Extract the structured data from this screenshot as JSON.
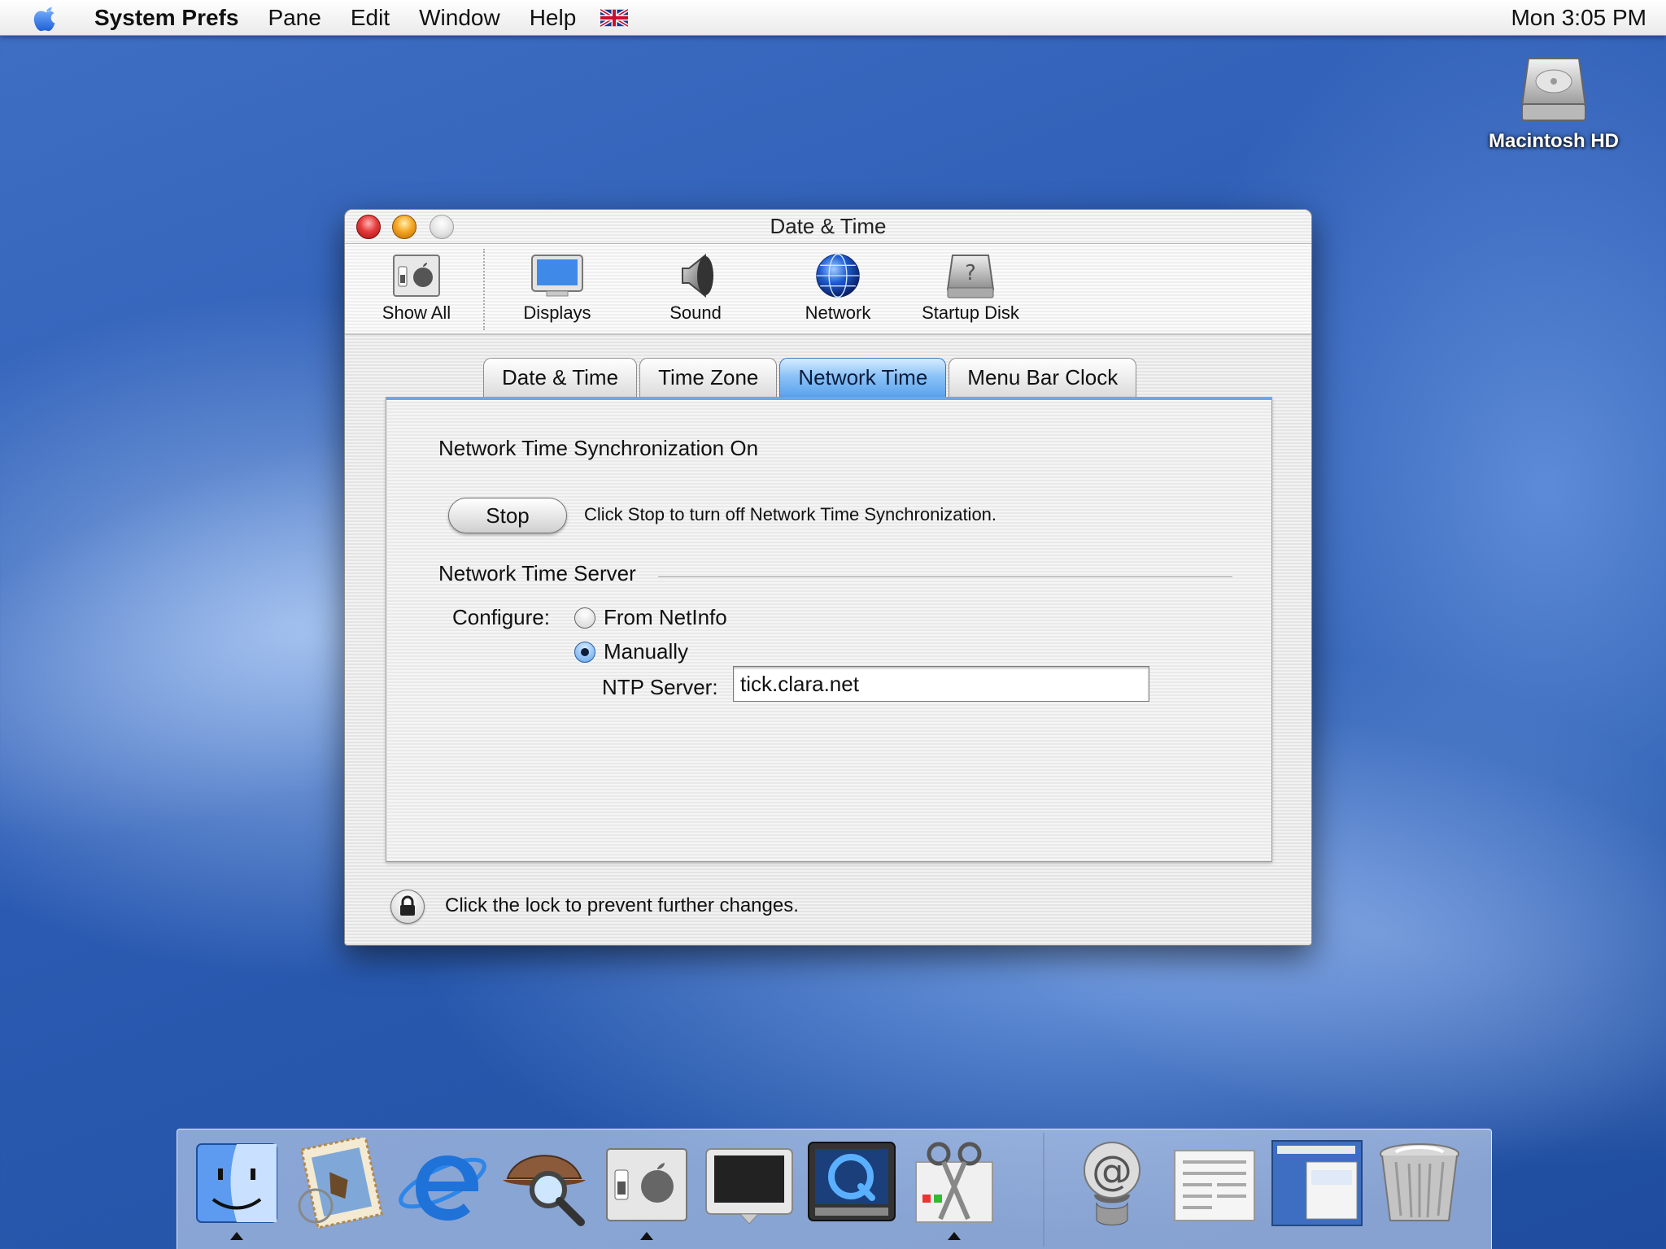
{
  "menubar": {
    "app_name": "System Prefs",
    "items": [
      "Pane",
      "Edit",
      "Window",
      "Help"
    ],
    "clock": "Mon 3:05 PM"
  },
  "desktop": {
    "drive_label": "Macintosh HD"
  },
  "window": {
    "title": "Date & Time",
    "toolbar": [
      {
        "label": "Show All",
        "icon": "switch-apple-icon"
      },
      {
        "label": "Displays",
        "icon": "monitor-icon"
      },
      {
        "label": "Sound",
        "icon": "speaker-icon"
      },
      {
        "label": "Network",
        "icon": "globe-icon"
      },
      {
        "label": "Startup Disk",
        "icon": "hard-disk-question-icon"
      }
    ],
    "tabs": [
      {
        "label": "Date & Time",
        "active": false
      },
      {
        "label": "Time Zone",
        "active": false
      },
      {
        "label": "Network Time",
        "active": true
      },
      {
        "label": "Menu Bar Clock",
        "active": false
      }
    ],
    "panel": {
      "status": "Network Time Synchronization On",
      "stop_button": "Stop",
      "stop_hint": "Click Stop to turn off Network Time Synchronization.",
      "server_group_label": "Network Time Server",
      "configure_label": "Configure:",
      "options": [
        {
          "label": "From NetInfo",
          "selected": false
        },
        {
          "label": "Manually",
          "selected": true
        }
      ],
      "ntp_label": "NTP Server:",
      "ntp_value": "tick.clara.net"
    },
    "lock_text": "Click the lock to prevent further changes."
  },
  "dock": {
    "items": [
      "finder-icon",
      "mail-stamp-icon",
      "internet-explorer-icon",
      "sherlock-icon",
      "system-preferences-icon",
      "display-icon",
      "quicktime-icon",
      "grab-scissors-icon",
      "mail-at-icon",
      "document-icon",
      "window-icon",
      "trash-icon"
    ]
  },
  "colors": {
    "accent": "#5aa2ec",
    "desktop": "#2c5bb4"
  }
}
